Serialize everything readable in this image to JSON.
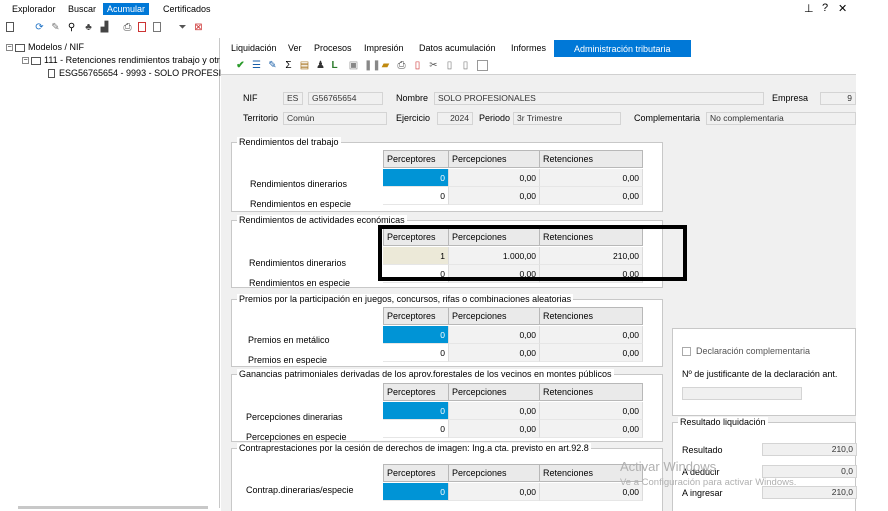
{
  "menu": {
    "explorador": "Explorador",
    "buscar": "Buscar",
    "acumular": "Acumular",
    "certificados": "Certificados"
  },
  "window": {
    "pin": "⊥",
    "help": "?",
    "close": "✕"
  },
  "tree": {
    "root": "Modelos / NIF",
    "model": "111 - Retenciones rendimientos trabajo y otr",
    "item": "ESG56765654 - 9993 - SOLO PROFESIONA"
  },
  "tabs": {
    "liquidacion": "Liquidación",
    "ver": "Ver",
    "procesos": "Procesos",
    "impresion": "Impresión",
    "datos": "Datos acumulación",
    "informes": "Informes",
    "admin": "Administración tributaria"
  },
  "header": {
    "nif_label": "NIF",
    "nif_country": "ES",
    "nif_value": "G56765654",
    "nombre_label": "Nombre",
    "nombre_value": "SOLO PROFESIONALES",
    "empresa_label": "Empresa",
    "empresa_value": "9",
    "territorio_label": "Territorio",
    "territorio_value": "Común",
    "ejercicio_label": "Ejercicio",
    "ejercicio_value": "2024",
    "periodo_label": "Periodo",
    "periodo_value": "3r Trimestre",
    "complementaria_label": "Complementaria",
    "complementaria_value": "No complementaria"
  },
  "columns": [
    "Perceptores",
    "Percepciones",
    "Retenciones"
  ],
  "sections": [
    {
      "title": "Rendimientos del trabajo",
      "rows": [
        {
          "label": "Rendimientos dinerarios",
          "perceptores": "0",
          "percepciones": "0,00",
          "retenciones": "0,00"
        },
        {
          "label": "Rendimientos en especie",
          "perceptores": "0",
          "percepciones": "0,00",
          "retenciones": "0,00"
        }
      ]
    },
    {
      "title": "Rendimientos de actividades económicas",
      "rows": [
        {
          "label": "Rendimientos dinerarios",
          "perceptores": "1",
          "percepciones": "1.000,00",
          "retenciones": "210,00"
        },
        {
          "label": "Rendimientos en especie",
          "perceptores": "0",
          "percepciones": "0,00",
          "retenciones": "0,00"
        }
      ]
    },
    {
      "title": "Premios por la participación en juegos, concursos, rifas o combinaciones aleatorias",
      "rows": [
        {
          "label": "Premios en metálico",
          "perceptores": "0",
          "percepciones": "0,00",
          "retenciones": "0,00"
        },
        {
          "label": "Premios en especie",
          "perceptores": "0",
          "percepciones": "0,00",
          "retenciones": "0,00"
        }
      ]
    },
    {
      "title": "Ganancias patrimoniales derivadas de los aprov.forestales de los vecinos en montes públicos",
      "rows": [
        {
          "label": "Percepciones dinerarias",
          "perceptores": "0",
          "percepciones": "0,00",
          "retenciones": "0,00"
        },
        {
          "label": "Percepciones en especie",
          "perceptores": "0",
          "percepciones": "0,00",
          "retenciones": "0,00"
        }
      ]
    },
    {
      "title": "Contraprestaciones por la cesión de derechos de imagen: Ing.a cta. previsto en art.92.8",
      "rows": [
        {
          "label": "Contrap.dinerarias/especie",
          "perceptores": "0",
          "percepciones": "0,00",
          "retenciones": "0,00"
        }
      ]
    }
  ],
  "right": {
    "decl_compl": "Declaración complementaria",
    "num_justificante": "Nº de justificante de la declaración ant.",
    "resultado_title": "Resultado liquidación",
    "resultado_label": "Resultado",
    "resultado_value": "210,0",
    "deducir_label": "A deducir",
    "deducir_value": "0,0",
    "ingresar_label": "A ingresar",
    "ingresar_value": "210,0"
  },
  "watermark": {
    "line1": "Activar Windows",
    "line2": "Ve a Configuración para activar Windows."
  },
  "colors": {
    "accent": "#0078d7",
    "selected_cell": "#0094d6"
  }
}
